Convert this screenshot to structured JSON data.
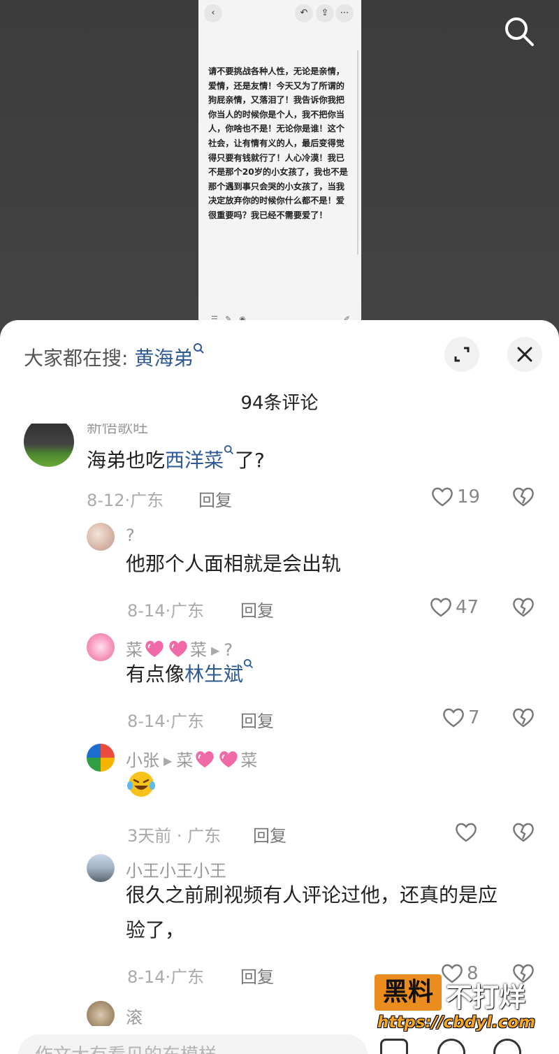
{
  "video": {
    "note_text": "请不要挑战各种人性，无论是亲情，爱情，还是友情！今天又为了所谓的狗屁亲情，又落泪了！我告诉你我把你当人的时候你是个人，我不把你当人，你啥也不是！无论你是谁！这个社会，让有情有义的人，最后变得觉得只要有钱就行了！人心冷漠！我已不是那个20岁的小女孩了，我也不是那个遇到事只会哭的小女孩了，当我决定放弃你的时候你什么都不是！爱很重要吗？我已经不需要爱了！"
  },
  "sheet": {
    "hot_search_prefix": "大家都在搜:",
    "hot_search_keyword": "黄海弟",
    "comment_count": "94条评论"
  },
  "comments": [
    {
      "username": "新悟歌旺",
      "text_before": "海弟也吃",
      "text_keyword": "西洋菜",
      "text_after": "了?",
      "date": "8-12",
      "location": "广东",
      "reply": "回复",
      "likes": "19"
    },
    {
      "username": "?",
      "text": "他那个人面相就是会出轨",
      "date": "8-14",
      "location": "广东",
      "reply": "回复",
      "likes": "47"
    },
    {
      "username_a": "菜",
      "username_b": "菜",
      "reply_to": "?",
      "text_before": "有点像",
      "text_keyword": "林生斌",
      "date": "8-14",
      "location": "广东",
      "reply": "回复",
      "likes": "7"
    },
    {
      "username": "小张",
      "reply_to_a": "菜",
      "reply_to_b": "菜",
      "text": "😂",
      "date": "3天前",
      "location": "广东",
      "reply": "回复",
      "likes": ""
    },
    {
      "username": "小王小王小王",
      "text_line1": "很久之前刷视频有人评论过他，还真的是应",
      "text_line2": "验了，",
      "date": "8-14",
      "location": "广东",
      "reply": "回复",
      "likes": "8"
    },
    {
      "username": "滚"
    }
  ],
  "input": {
    "placeholder": "作文大有看见的东模样"
  },
  "watermark": {
    "brand": "黑料",
    "slogan": "不打烊",
    "url": "https://cbdyl.com"
  },
  "colors": {
    "keyword_blue": "#2e5a95",
    "watermark_orange": "#ea8d1e"
  }
}
